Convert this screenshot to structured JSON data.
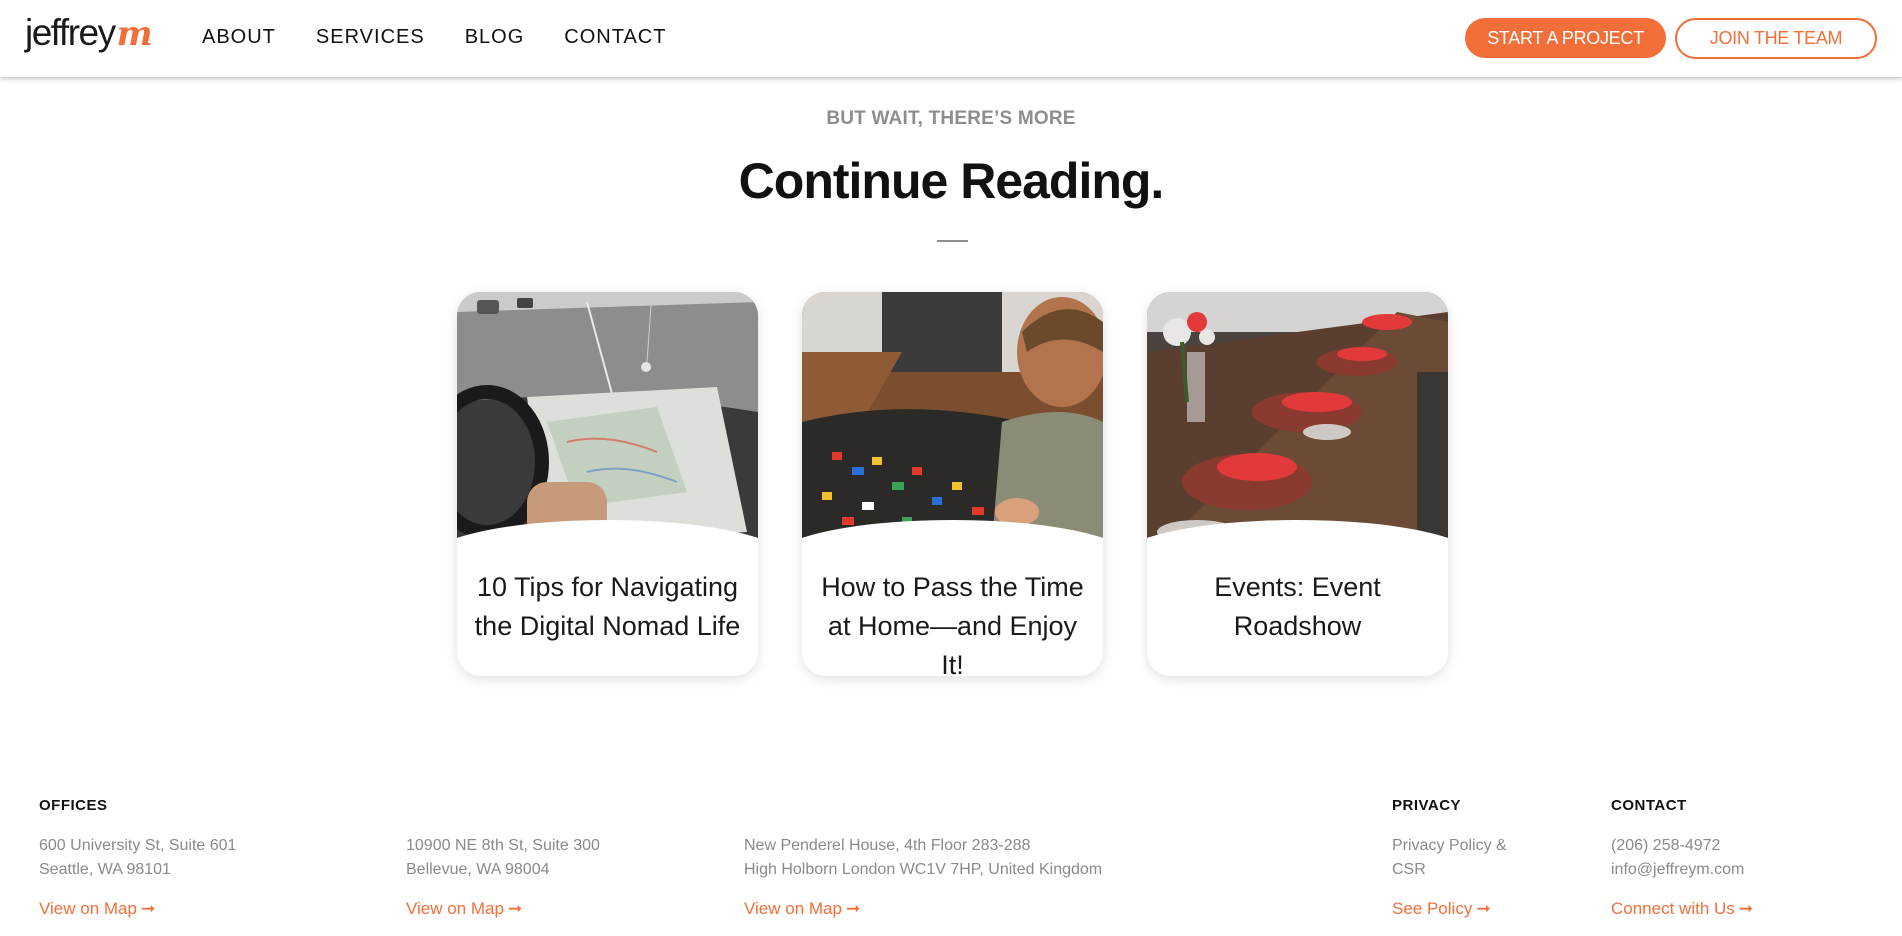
{
  "header": {
    "logo_word": "jeffrey",
    "logo_mark": "m",
    "nav": [
      "ABOUT",
      "SERVICES",
      "BLOG",
      "CONTACT"
    ],
    "cta_primary": "START A PROJECT",
    "cta_secondary": "JOIN THE TEAM"
  },
  "section": {
    "eyebrow": "BUT WAIT, THERE’S MORE",
    "title": "Continue Reading."
  },
  "cards": [
    {
      "title": "10 Tips for Navigating the Digital Nomad Life",
      "image": "road-map-photo"
    },
    {
      "title": "How to Pass the Time at Home—and Enjoy It!",
      "image": "child-lego-photo"
    },
    {
      "title": "Events: Event Roadshow",
      "image": "dinner-table-photo"
    }
  ],
  "footer": {
    "offices_heading": "OFFICES",
    "offices": [
      {
        "line1": "600 University St, Suite 601",
        "line2": "Seattle, WA 98101",
        "link": "View on Map"
      },
      {
        "line1": "10900 NE 8th St, Suite 300",
        "line2": "Bellevue, WA 98004",
        "link": "View on Map"
      },
      {
        "line1": "New Penderel House, 4th Floor 283-288",
        "line2": "High Holborn London WC1V 7HP, United Kingdom",
        "link": "View on Map"
      }
    ],
    "privacy": {
      "heading": "PRIVACY",
      "line1": "Privacy Policy &",
      "line2": "CSR",
      "link": "See Policy"
    },
    "contact": {
      "heading": "CONTACT",
      "line1": "(206) 258-4972",
      "line2": "info@jeffreym.com",
      "link": "Connect with Us"
    },
    "arrow": "➞"
  },
  "colors": {
    "accent": "#f26f3a",
    "muted": "#8a8a8a",
    "text": "#111111"
  }
}
